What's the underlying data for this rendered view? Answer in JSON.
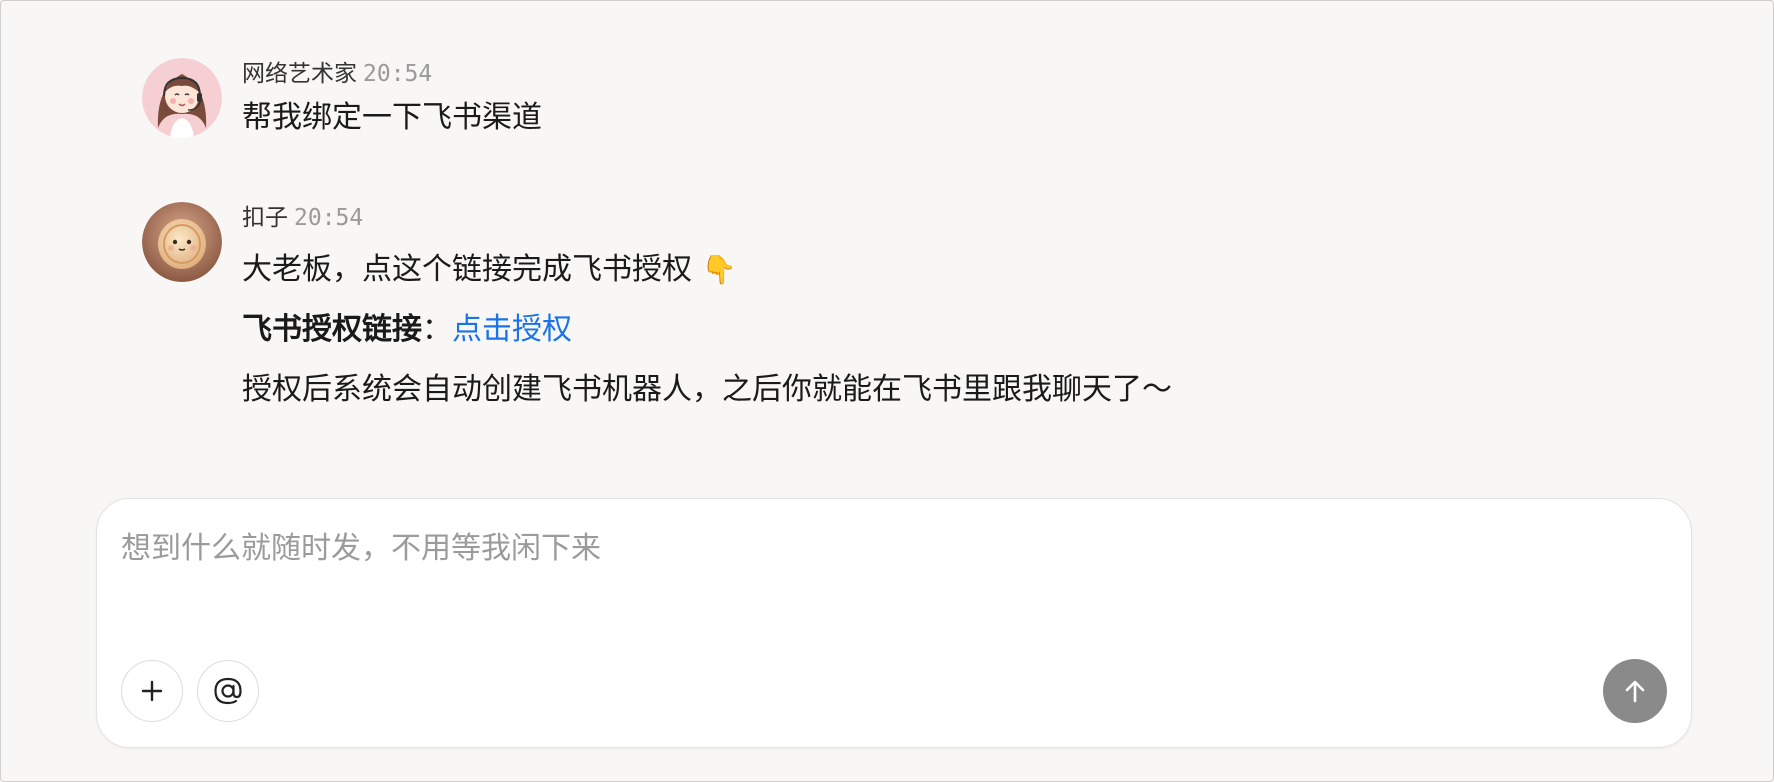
{
  "messages": [
    {
      "sender": "网络艺术家",
      "time": "20:54",
      "text": "帮我绑定一下飞书渠道"
    },
    {
      "sender": "扣子",
      "time": "20:54",
      "line1": "大老板，点这个链接完成飞书授权",
      "line1_emoji": "👇",
      "link_label": "飞书授权链接",
      "link_colon": "：",
      "link_text": "点击授权",
      "line3": "授权后系统会自动创建飞书机器人，之后你就能在飞书里跟我聊天了～"
    }
  ],
  "composer": {
    "placeholder": "想到什么就随时发，不用等我闲下来",
    "value": ""
  },
  "colors": {
    "background": "#f8f7f5",
    "link": "#1a73e8",
    "send_button": "#8a8a8a"
  },
  "icons": {
    "attach": "plus-icon",
    "mention": "at-icon",
    "send": "arrow-up-icon"
  }
}
